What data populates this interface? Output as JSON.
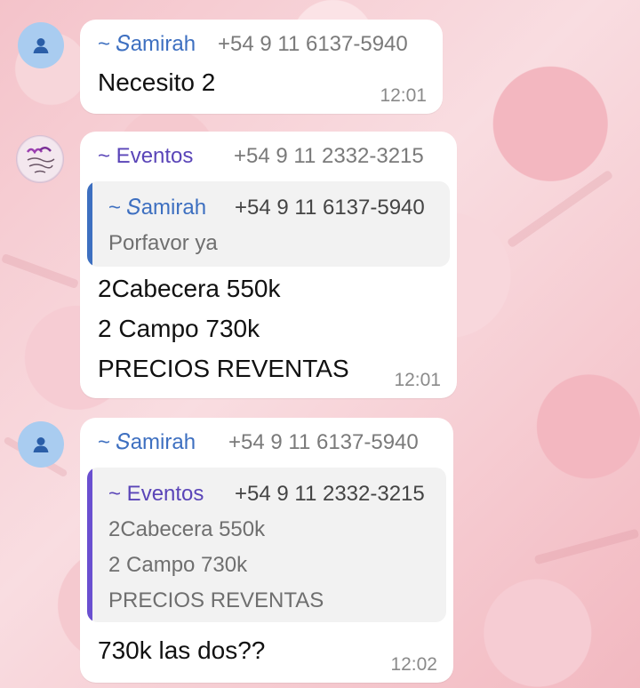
{
  "colors": {
    "samirah": "#3d6fc0",
    "eventos": "#5a45b8",
    "quote_bar_blue": "#3d6fc0",
    "quote_bar_purple": "#6a4fd0"
  },
  "messages": [
    {
      "avatar": "person-icon",
      "sender": "~ 𝑆amirah",
      "phone": "+54 9 11 6137-5940",
      "lines": [
        "Necesito 2"
      ],
      "time": "12:01"
    },
    {
      "avatar": "group-avatar",
      "sender": "~ Eventos",
      "phone": "+54 9 11 2332-3215",
      "quote": {
        "sender": "~ 𝑆amirah",
        "phone": "+54 9 11 6137-5940",
        "lines": [
          "Porfavor ya"
        ]
      },
      "lines": [
        "2Cabecera 550k",
        "2 Campo 730k",
        "PRECIOS REVENTAS"
      ],
      "time": "12:01"
    },
    {
      "avatar": "person-icon",
      "sender": "~ 𝑆amirah",
      "phone": "+54 9 11 6137-5940",
      "quote": {
        "sender": "~ Eventos",
        "phone": "+54 9 11 2332-3215",
        "lines": [
          "2Cabecera 550k",
          "2 Campo 730k",
          "PRECIOS REVENTAS"
        ]
      },
      "lines": [
        "730k las dos??"
      ],
      "time": "12:02"
    }
  ]
}
